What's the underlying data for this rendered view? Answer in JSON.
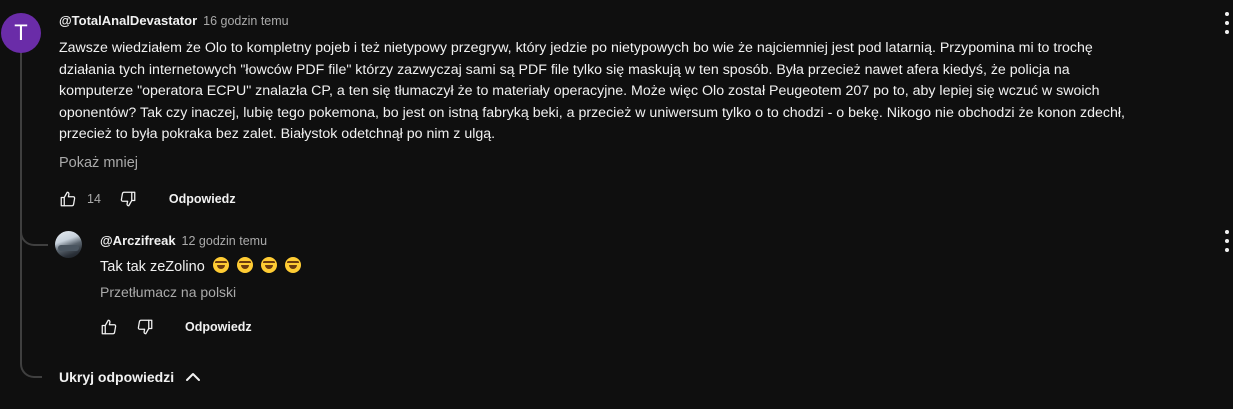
{
  "comment": {
    "avatar_letter": "T",
    "avatar_color": "#6a2ca8",
    "author": "@TotalAnalDevastator",
    "time": "16 godzin temu",
    "text_lines": [
      "Zawsze wiedziałem że Olo to kompletny pojeb i też nietypowy przegryw, który jedzie po nietypowych bo wie że najciemniej jest pod latarnią. Przypomina mi to trochę",
      "działania tych internetowych \"łowców PDF file\" którzy zazwyczaj sami są PDF file tylko się maskują w ten sposób. Była przecież nawet afera kiedyś, że policja na",
      "komputerze \"operatora ECPU\" znalazła CP, a ten się tłumaczył że to materiały operacyjne. Może więc Olo został Peugeotem 207 po to, aby lepiej się wczuć w swoich",
      "oponentów? Tak czy inaczej, lubię tego pokemona, bo jest on istną fabryką beki, a przecież w uniwersum tylko o to chodzi - o bekę. Nikogo nie obchodzi że konon zdechł,",
      "przecież to była pokraka bez zalet. Białystok odetchnął po nim z ulgą."
    ],
    "show_less": "Pokaż mniej",
    "like_count": "14",
    "reply_label": "Odpowiedz"
  },
  "reply": {
    "author": "@Arczifreak",
    "time": "12 godzin temu",
    "text": "Tak tak zeZolino",
    "emoji_count": 4,
    "translate": "Przetłumacz na polski",
    "reply_label": "Odpowiedz"
  },
  "hide_replies": "Ukryj odpowiedzi",
  "icons": {
    "like": "thumbs-up-icon",
    "dislike": "thumbs-down-icon",
    "more": "more-vert-icon",
    "chevron": "chevron-up-icon"
  }
}
